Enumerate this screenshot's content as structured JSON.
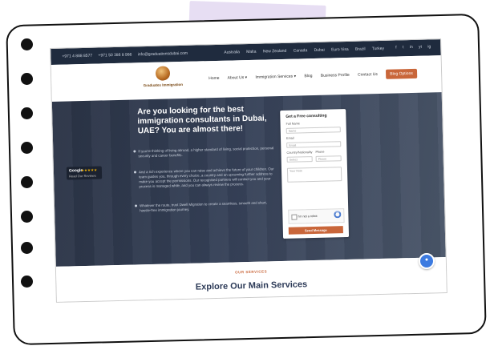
{
  "topbar": {
    "contacts": [
      "+971 4 888 8577",
      "+971 50 386 8 986",
      "info@graduationsdubai.com"
    ],
    "flags": [
      "Australia",
      "Malta",
      "New Zealand",
      "Canada",
      "Dubai",
      "Euro Visa",
      "Brazil",
      "Turkey"
    ],
    "social": [
      "f",
      "t",
      "in",
      "yt",
      "ig"
    ]
  },
  "logo": {
    "name": "Graduates Immigration"
  },
  "menu": {
    "items": [
      "Home",
      "About Us ▾",
      "Immigration Services ▾",
      "Blog",
      "Business Profile",
      "Contact Us"
    ],
    "cta": "Blog Options"
  },
  "hero": {
    "heading": "Are you looking for the best immigration consultants in Dubai, UAE? You are almost there!",
    "paragraphs": [
      "If you're thinking of living abroad, a higher standard of living, social protection, personal security and career benefits.",
      "And a rich experience where you can raise and achieve the future of your children. Our team guides you, through every choice, a country and an upcoming further address to make you accept the permissions. Our recognised partners will contact you and your process is managed while, and you can always review the process.",
      "Whatever the route, trust Dwell Migration to create a seamless, smooth and short, hassle-free immigration journey."
    ],
    "badge": {
      "brand": "Google",
      "stars": "★★★★★",
      "reviews": "Read Our Reviews"
    }
  },
  "form": {
    "title": "Get a Free consulting",
    "fields": [
      {
        "label": "Full Name",
        "placeholder": "Name"
      },
      {
        "label": "Email",
        "placeholder": "Email"
      }
    ],
    "country_label": "Country/Nationality",
    "country_placeholder": "Select",
    "phone_label": "Phone",
    "phone_placeholder": "Phone",
    "message_placeholder": "Your Note",
    "captcha": "I'm not a robot",
    "submit": "Send Message"
  },
  "below": {
    "overline": "OUR SERVICES",
    "title": "Explore Our Main Services"
  },
  "colors": {
    "accent": "#c9663a",
    "dark": "#1f2b3e",
    "chat": "#3d7be0"
  }
}
